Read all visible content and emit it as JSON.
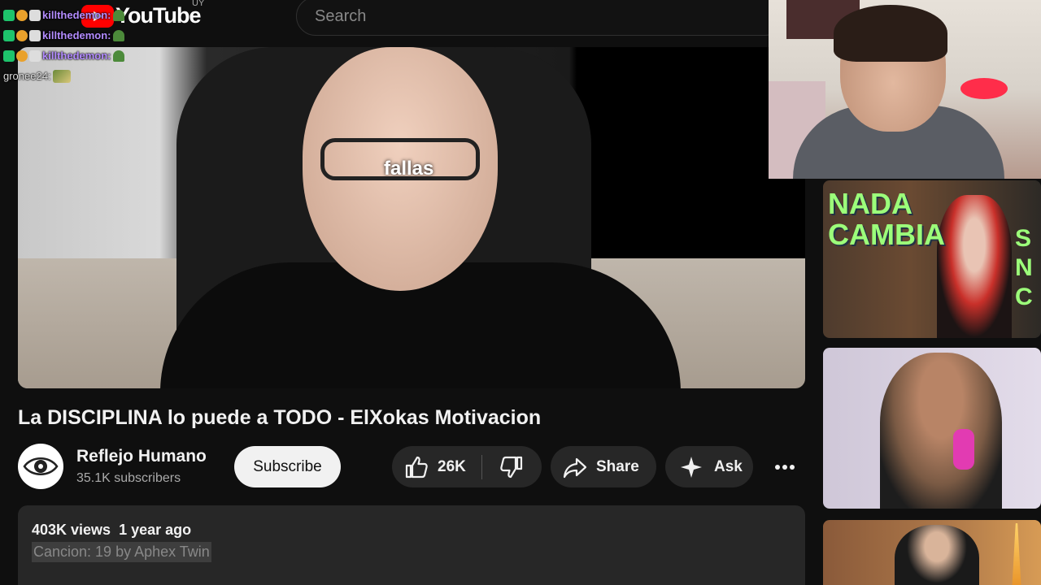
{
  "header": {
    "logo_text": "YouTube",
    "country": "UY",
    "search_placeholder": "Search"
  },
  "chat": [
    {
      "user": "killthedemon:"
    },
    {
      "user": "killthedemon:"
    },
    {
      "user": "killthedemon:"
    },
    {
      "user": "gronee24:"
    }
  ],
  "video": {
    "caption": "fallas",
    "title": "La DISCIPLINA lo puede a TODO - ElXokas Motivacion"
  },
  "channel": {
    "name": "Reflejo Humano",
    "subscribers": "35.1K subscribers",
    "subscribe_label": "Subscribe"
  },
  "actions": {
    "likes": "26K",
    "share_label": "Share",
    "ask_label": "Ask"
  },
  "description": {
    "views": "403K views",
    "date": "1 year ago",
    "song": "Cancion: 19 by Aphex Twin"
  },
  "side": {
    "card1_left": "NADA\nCAMBIA",
    "card1_right": "S\nN\nC"
  },
  "colors": {
    "background": "#0f0f0f",
    "pill": "#272727",
    "accent_red": "#ff0000",
    "chat_name": "#b38cff",
    "overlay_green": "#9cff7a"
  }
}
